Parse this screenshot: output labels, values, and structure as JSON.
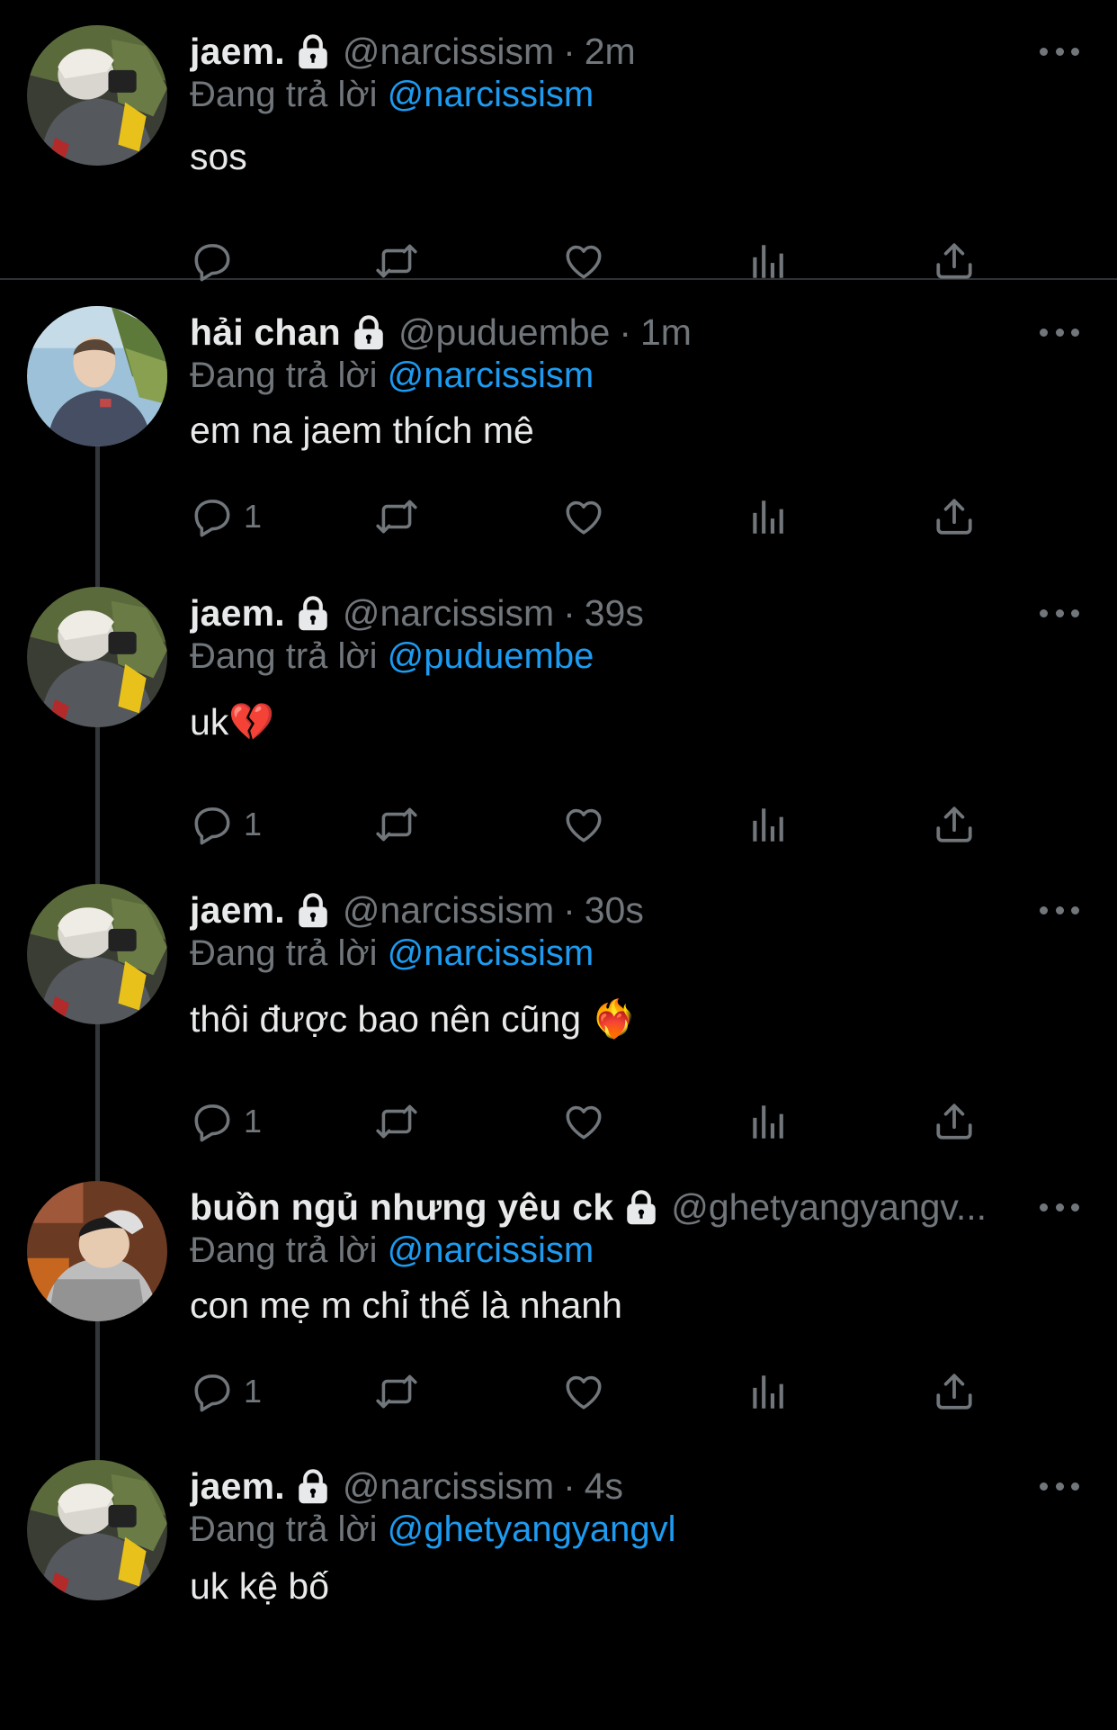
{
  "replying_prefix": "Đang trả lời",
  "icons": {
    "lock": "lock-icon",
    "reply": "speech-bubble-icon",
    "retweet": "retweet-icon",
    "like": "heart-icon",
    "views": "bar-chart-icon",
    "share": "share-upload-icon",
    "more": "more-horizontal-icon"
  },
  "colors": {
    "background": "#000000",
    "text": "#e7e9ea",
    "muted": "#71767b",
    "mention": "#1d9bf0"
  },
  "tweets": [
    {
      "name": "jaem.",
      "handle": "@narcissism",
      "time": "2m",
      "separator": "·",
      "replying_to": "@narcissism",
      "text": "sos",
      "reply_count": ""
    },
    {
      "name": "hải chan",
      "handle": "@puduembe",
      "time": "1m",
      "separator": "·",
      "replying_to": "@narcissism",
      "text": "em na jaem thích mê",
      "reply_count": "1"
    },
    {
      "name": "jaem.",
      "handle": "@narcissism",
      "time": "39s",
      "separator": "·",
      "replying_to": "@puduembe",
      "text": "uk💔",
      "reply_count": "1"
    },
    {
      "name": "jaem.",
      "handle": "@narcissism",
      "time": "30s",
      "separator": "·",
      "replying_to": "@narcissism",
      "text": "thôi được bao nên cũng ❤️‍🔥",
      "reply_count": "1"
    },
    {
      "name": "buồn ngủ nhưng yêu ck",
      "handle": "@ghetyangyangv...",
      "time": "",
      "separator": "",
      "replying_to": "@narcissism",
      "text": "con mẹ m chỉ thế là nhanh",
      "reply_count": "1"
    },
    {
      "name": "jaem.",
      "handle": "@narcissism",
      "time": "4s",
      "separator": "·",
      "replying_to": "@ghetyangyangvl",
      "text": "uk kệ bố",
      "reply_count": ""
    }
  ]
}
